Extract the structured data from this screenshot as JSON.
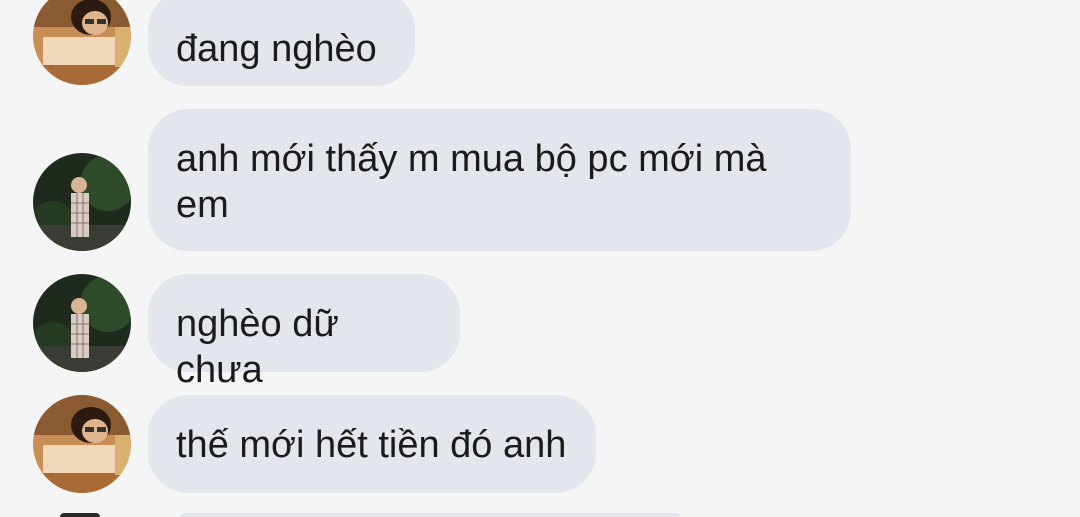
{
  "messages": [
    {
      "text": "đang nghèo",
      "avatar": "avatar-girl"
    },
    {
      "text": "anh mới thấy m mua bộ pc mới mà em",
      "avatar": "avatar-boy"
    },
    {
      "text": "nghèo dữ chưa",
      "avatar": "avatar-boy"
    },
    {
      "text": "thế mới hết tiền đó anh",
      "avatar": "avatar-girl"
    }
  ],
  "colors": {
    "background": "#f5f5f5",
    "bubble": "#e3e6ec",
    "text": "#1b1b1b"
  }
}
